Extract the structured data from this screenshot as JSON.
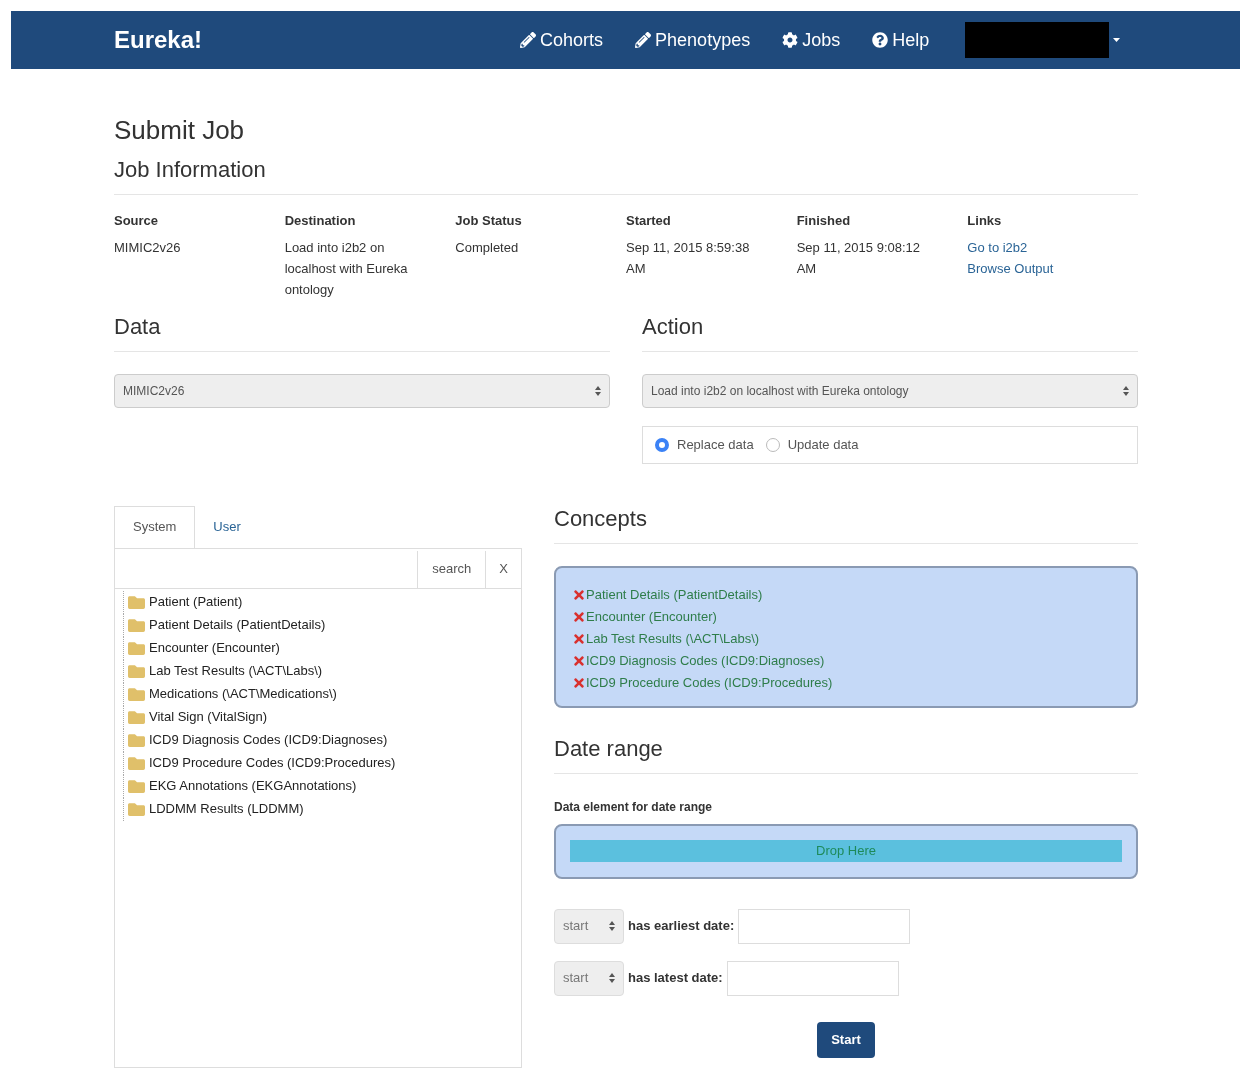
{
  "navbar": {
    "brand": "Eureka!",
    "items": [
      {
        "label": "Cohorts",
        "kind": "edit"
      },
      {
        "label": "Phenotypes",
        "kind": "edit"
      },
      {
        "label": "Jobs",
        "kind": "settings"
      },
      {
        "label": "Help",
        "kind": "help"
      }
    ]
  },
  "page_title": "Submit Job",
  "job_information": {
    "title": "Job Information",
    "columns": [
      {
        "header": "Source",
        "lines": [
          "MIMIC2v26"
        ]
      },
      {
        "header": "Destination",
        "lines": [
          "Load into i2b2 on localhost with Eureka ontology"
        ]
      },
      {
        "header": "Job Status",
        "lines": [
          "Completed"
        ]
      },
      {
        "header": "Started",
        "lines": [
          "Sep 11, 2015 8:59:38 AM"
        ]
      },
      {
        "header": "Finished",
        "lines": [
          "Sep 11, 2015 9:08:12 AM"
        ]
      },
      {
        "header": "Links",
        "lines": [
          "Go to i2b2",
          "Browse Output"
        ],
        "kind": "links"
      }
    ]
  },
  "data": {
    "title": "Data",
    "select": "MIMIC2v26"
  },
  "action": {
    "title": "Action",
    "select": "Load into i2b2 on localhost with Eureka ontology",
    "radios": [
      {
        "label": "Replace data",
        "selected": true
      },
      {
        "label": "Update data",
        "selected": false
      }
    ]
  },
  "tabs": [
    {
      "label": "System",
      "selected": true
    },
    {
      "label": "User",
      "selected": false
    }
  ],
  "search": {
    "button": "search",
    "clear": "X"
  },
  "tree": [
    "Patient (Patient)",
    "Patient Details (PatientDetails)",
    "Encounter (Encounter)",
    "Lab Test Results (\\ACT\\Labs\\)",
    "Medications (\\ACT\\Medications\\)",
    "Vital Sign (VitalSign)",
    "ICD9 Diagnosis Codes (ICD9:Diagnoses)",
    "ICD9 Procedure Codes (ICD9:Procedures)",
    "EKG Annotations (EKGAnnotations)",
    "LDDMM Results (LDDMM)"
  ],
  "concepts": {
    "title": "Concepts",
    "items": [
      "Patient Details (PatientDetails)",
      "Encounter (Encounter)",
      "Lab Test Results (\\ACT\\Labs\\)",
      "ICD9 Diagnosis Codes (ICD9:Diagnoses)",
      "ICD9 Procedure Codes (ICD9:Procedures)"
    ]
  },
  "date_range": {
    "title": "Date range",
    "element_label": "Data element for date range",
    "drop": "Drop Here",
    "rows": [
      {
        "select": "start",
        "label": "has earliest date:"
      },
      {
        "select": "start",
        "label": "has latest date:"
      }
    ]
  },
  "submit": "Start"
}
